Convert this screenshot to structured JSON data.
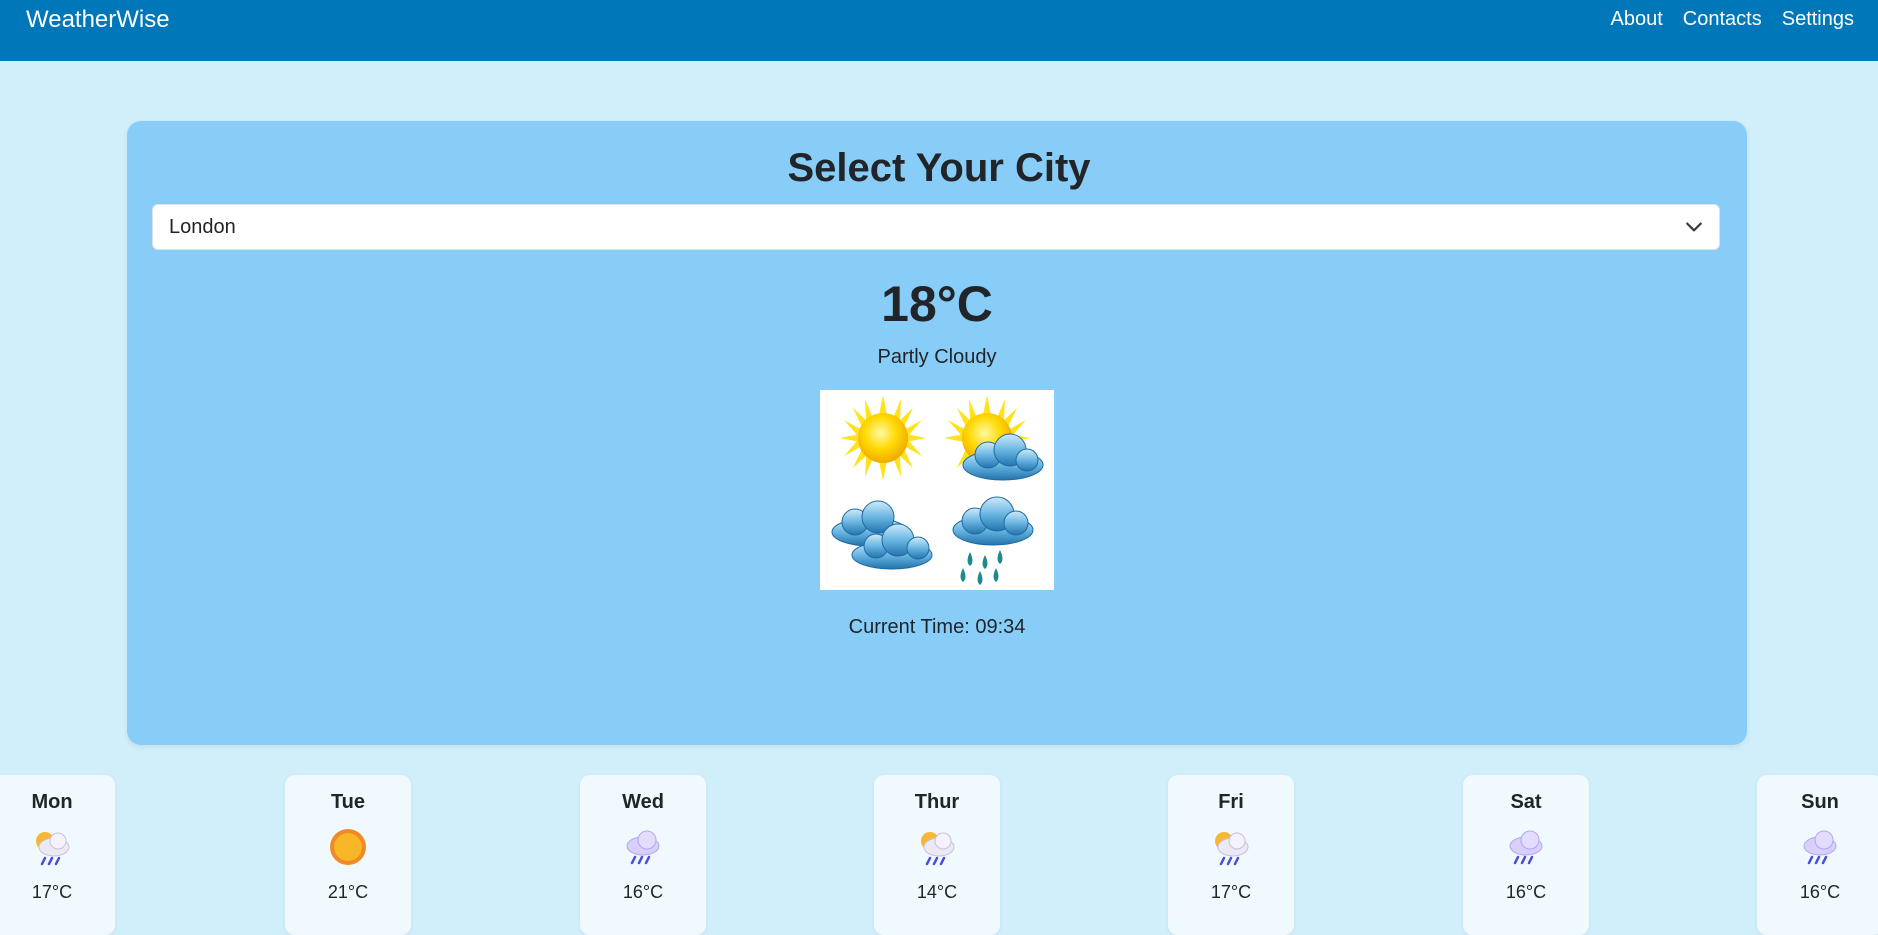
{
  "navbar": {
    "brand": "WeatherWise",
    "links": [
      "About",
      "Contacts",
      "Settings"
    ]
  },
  "main": {
    "title": "Select Your City",
    "city_select": {
      "selected": "London"
    },
    "temperature": "18°C",
    "condition": "Partly Cloudy",
    "time_label": "Current Time: 09:34"
  },
  "forecast": [
    {
      "day": "Mon",
      "icon": "sun-cloud-rain-icon",
      "temp": "17°C"
    },
    {
      "day": "Tue",
      "icon": "sun-icon",
      "temp": "21°C"
    },
    {
      "day": "Wed",
      "icon": "cloud-rain-icon",
      "temp": "16°C"
    },
    {
      "day": "Thur",
      "icon": "sun-cloud-rain-icon",
      "temp": "14°C"
    },
    {
      "day": "Fri",
      "icon": "sun-cloud-rain-icon",
      "temp": "17°C"
    },
    {
      "day": "Sat",
      "icon": "cloud-rain-icon",
      "temp": "16°C"
    },
    {
      "day": "Sun",
      "icon": "cloud-rain-icon",
      "temp": "16°C"
    }
  ],
  "colors": {
    "navbar": "#0077b9",
    "page_bg": "#d1effb",
    "card_bg": "#88cdf7",
    "forecast_bg": "#f0f9fd"
  }
}
